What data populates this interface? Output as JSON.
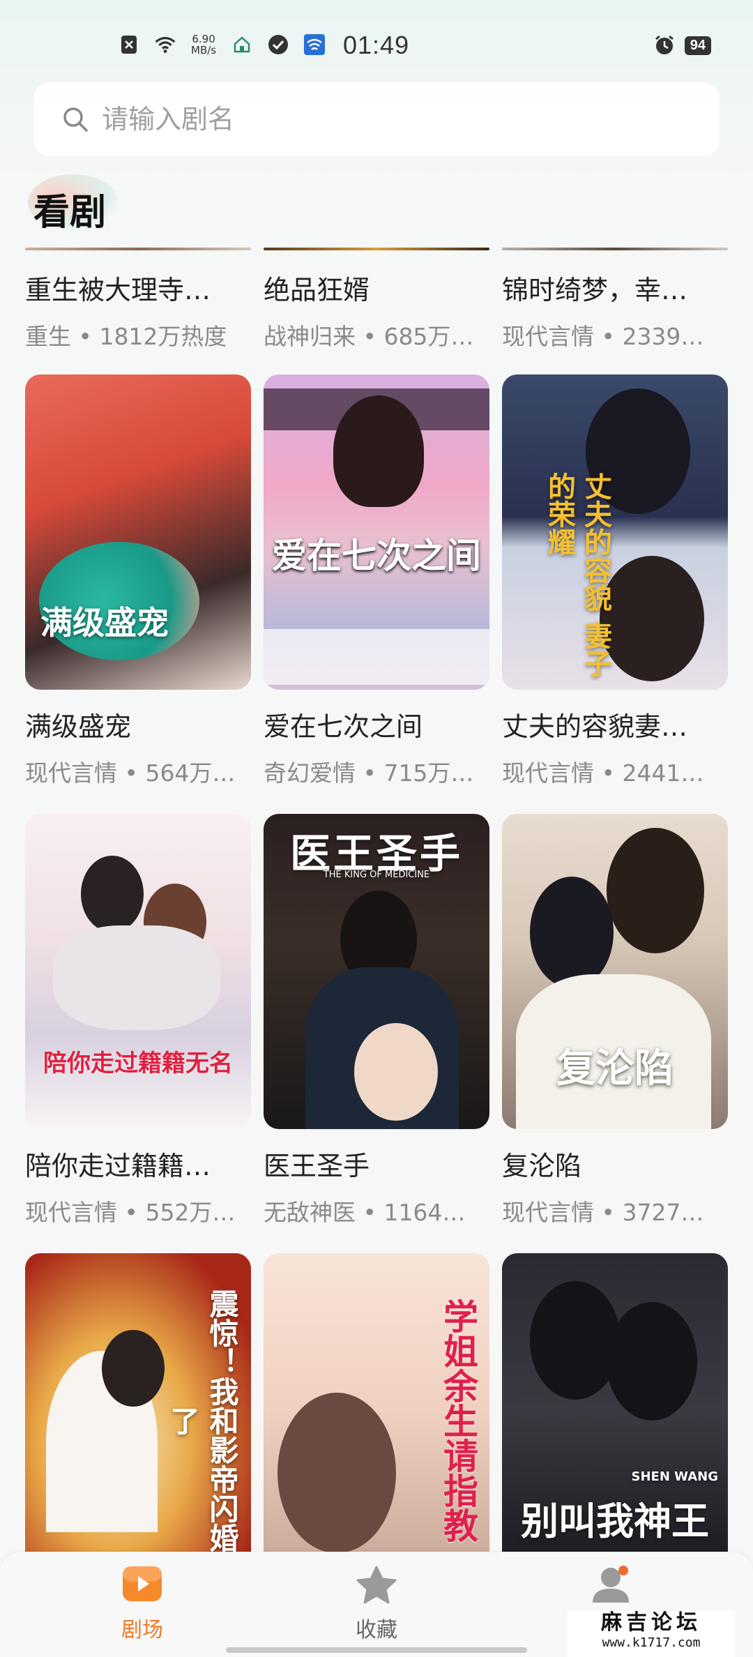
{
  "status_bar": {
    "speed_value": "6.90",
    "speed_unit": "MB/s",
    "time": "01:49",
    "battery": "94",
    "icons": [
      "nfc-icon",
      "wifi-icon",
      "home-icon",
      "check-icon",
      "app-icon",
      "alarm-icon"
    ]
  },
  "search": {
    "placeholder": "请输入剧名"
  },
  "section": {
    "title": "看剧"
  },
  "dramas": [
    {
      "title": "重生被大理寺…",
      "meta": "重生 • 1812万热度"
    },
    {
      "title": "绝品狂婿",
      "meta": "战神归来 • 685万…"
    },
    {
      "title": "锦时绮梦，幸…",
      "meta": "现代言情 • 2339…"
    },
    {
      "title": "满级盛宠",
      "meta": "现代言情 • 564万…",
      "poster_text": "满级盛宠"
    },
    {
      "title": "爱在七次之间",
      "meta": "奇幻爱情 • 715万…",
      "poster_text": "爱在七次之间"
    },
    {
      "title": "丈夫的容貌妻…",
      "meta": "现代言情 • 2441…",
      "poster_text": "丈夫的容貌 妻子的荣耀"
    },
    {
      "title": "陪你走过籍籍…",
      "meta": "现代言情 • 552万…",
      "poster_text": "陪你走过籍籍无名"
    },
    {
      "title": "医王圣手",
      "meta": "无敌神医 • 1164…",
      "poster_text": "医王圣手",
      "poster_sub": "THE KING OF MEDICINE"
    },
    {
      "title": "复沦陷",
      "meta": "现代言情 • 3727…",
      "poster_text": "复沦陷"
    },
    {
      "poster_text": "震惊！我和影帝闪婚了"
    },
    {
      "poster_text": "学姐余生请指教"
    },
    {
      "poster_text": "别叫我神王",
      "poster_sub": "SHEN WANG"
    }
  ],
  "nav": {
    "home_label": "剧场",
    "fav_label": "收藏"
  },
  "watermark": {
    "title": "麻吉论坛",
    "url": "www.k1717.com"
  },
  "colors": {
    "accent": "#f07a2a",
    "text": "#222222",
    "meta": "#8a8a8a"
  }
}
